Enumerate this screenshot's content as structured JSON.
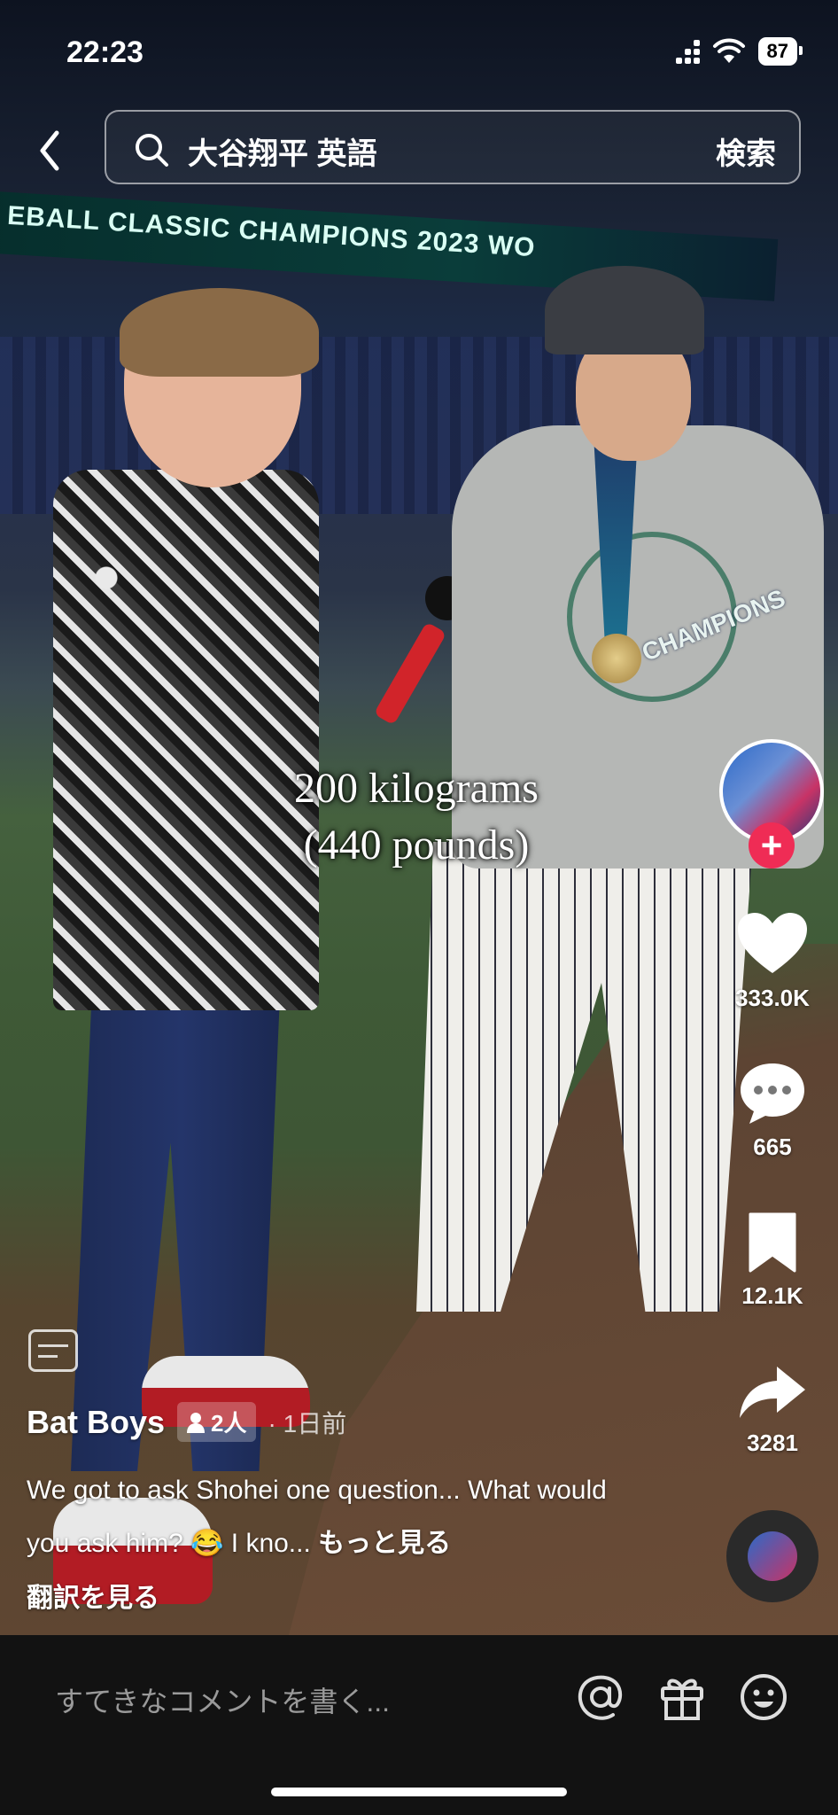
{
  "status_bar": {
    "time": "22:23",
    "battery": "87"
  },
  "header": {
    "search_query": "大谷翔平 英語",
    "search_button": "検索"
  },
  "video": {
    "banner_text": "EBALL CLASSIC CHAMPIONS   2023 WO",
    "caption_line1": "200 kilograms",
    "caption_line2": "(440 pounds)",
    "shirt_logo_text": "CHAMPIONS"
  },
  "actions": {
    "likes": "333.0K",
    "comments": "665",
    "saves": "12.1K",
    "shares": "3281"
  },
  "post": {
    "author": "Bat Boys",
    "collab_count": "2人",
    "time_ago": "· 1日前",
    "description": "We got to ask Shohei one question... What would you ask him? 😂 I kno...",
    "more_label": "もっと見る",
    "translate_label": "翻訳を見る"
  },
  "comment_bar": {
    "placeholder": "すてきなコメントを書く..."
  },
  "icons": [
    "back-icon",
    "search-icon",
    "heart-icon",
    "comment-icon",
    "bookmark-icon",
    "share-icon",
    "subtitle-icon",
    "mention-icon",
    "gift-icon",
    "emoji-icon"
  ]
}
